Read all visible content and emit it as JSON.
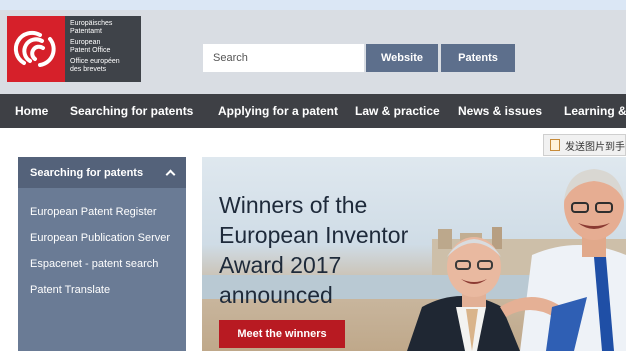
{
  "logo": {
    "lines_de": [
      "Europäisches",
      "Patentamt"
    ],
    "lines_en": [
      "European",
      "Patent Office"
    ],
    "lines_fr": [
      "Office européen",
      "des brevets"
    ]
  },
  "search": {
    "placeholder": "Search",
    "scope_website": "Website",
    "scope_patents": "Patents"
  },
  "nav": {
    "items": [
      "Home",
      "Searching for patents",
      "Applying for a patent",
      "Law & practice",
      "News & issues",
      "Learning &"
    ]
  },
  "translate_chip": {
    "label": "发送图片到手机"
  },
  "sidebar": {
    "title": "Searching for patents",
    "links": [
      "European Patent Register",
      "European Publication Server",
      "Espacenet - patent search",
      "Patent Translate"
    ]
  },
  "hero": {
    "title_lines": [
      "Winners of the",
      "European Inventor",
      "Award 2017",
      "announced"
    ],
    "cta": "Meet the winners"
  },
  "colors": {
    "brand_red": "#d6202a",
    "nav_bg": "#3e4045",
    "sidebar_bg": "#6a7b95",
    "cta_red": "#b81a22",
    "scope_button": "#5d6f8c"
  }
}
